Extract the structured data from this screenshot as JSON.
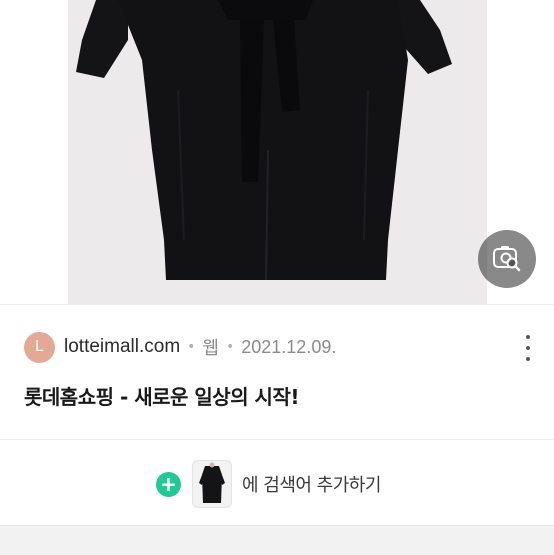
{
  "result": {
    "favicon_letter": "L",
    "domain": "lotteimall.com",
    "type": "웹",
    "date": "2021.12.09.",
    "title": "롯데홈쇼핑 - 새로운 일상의 시작!"
  },
  "icons": {
    "lens": "image-search-icon",
    "more": "more-vertical-icon",
    "add": "plus-icon"
  },
  "add_search": {
    "label": "에 검색어 추가하기"
  },
  "colors": {
    "accent": "#20c997",
    "favicon_bg": "#e3a995",
    "image_bg": "#eceaeb",
    "coat": "#121215"
  }
}
